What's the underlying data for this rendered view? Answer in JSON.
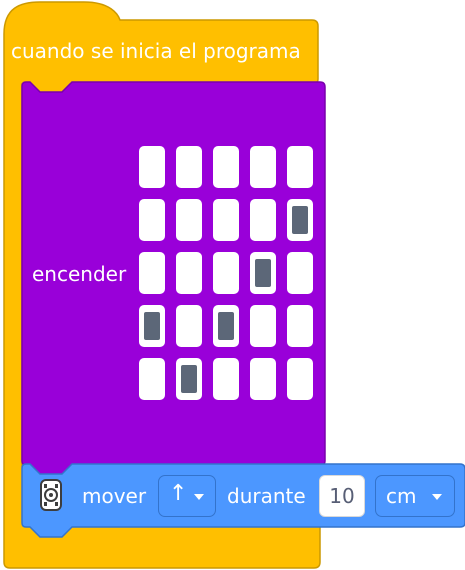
{
  "hat_block": {
    "label": "cuando se inicia el programa",
    "color": "#ffbf00",
    "border_color": "#cc9900"
  },
  "light_block": {
    "label": "encender",
    "color": "#9900d9",
    "border_color": "#7a00ad",
    "matrix": [
      [
        0,
        0,
        0,
        0,
        0
      ],
      [
        0,
        0,
        0,
        0,
        1
      ],
      [
        0,
        0,
        0,
        1,
        0
      ],
      [
        1,
        0,
        1,
        0,
        0
      ],
      [
        0,
        1,
        0,
        0,
        0
      ]
    ]
  },
  "move_block": {
    "icon": "robot-icon",
    "label": "mover",
    "direction": "↑",
    "during_label": "durante",
    "distance": "10",
    "unit": "cm",
    "color": "#4c97ff",
    "border_color": "#3373cc"
  }
}
